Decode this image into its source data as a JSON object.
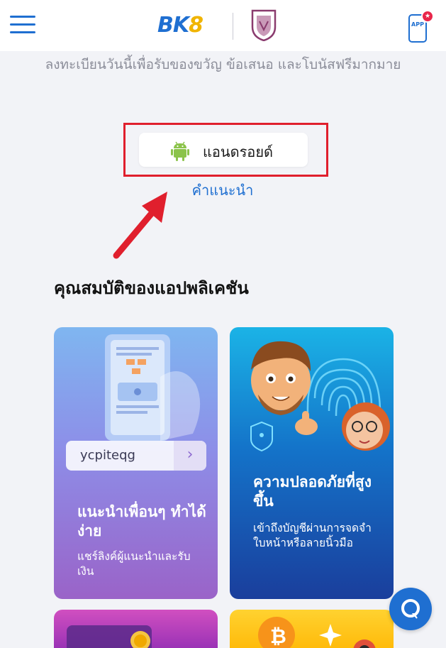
{
  "header": {
    "logo_text": "BK",
    "logo_accent": "8",
    "app_label": "APP",
    "app_badge": "★"
  },
  "promo": {
    "text": "ลงทะเบียนวันนี้เพื่อรับของขวัญ ข้อเสนอ และโบนัสฟรีมากมาย"
  },
  "download": {
    "android_label": "แอนดรอยด์",
    "guide_link": "คำแนะนำ"
  },
  "features": {
    "title": "คุณสมบัติของแอปพลิเคชัน",
    "cards": [
      {
        "title": "แนะนำเพื่อนๆ ทำได้ง่าย",
        "desc": "แชร์ลิงค์ผู้แนะนำและรับเงิน",
        "ref_code": "ycpiteqg",
        "ref_arrow": "›"
      },
      {
        "title": "ความปลอดภัยที่สูงขึ้น",
        "desc": "เข้าถึงบัญชีผ่านการจดจำใบหน้าหรือลายนิ้วมือ"
      }
    ]
  },
  "colors": {
    "brand_blue": "#1f6fd1",
    "brand_yellow": "#f0b400",
    "highlight_red": "#e01f2d"
  },
  "icons": {
    "menu": "hamburger-icon",
    "app": "phone-app-icon",
    "android": "android-icon",
    "chat": "chat-icon"
  }
}
